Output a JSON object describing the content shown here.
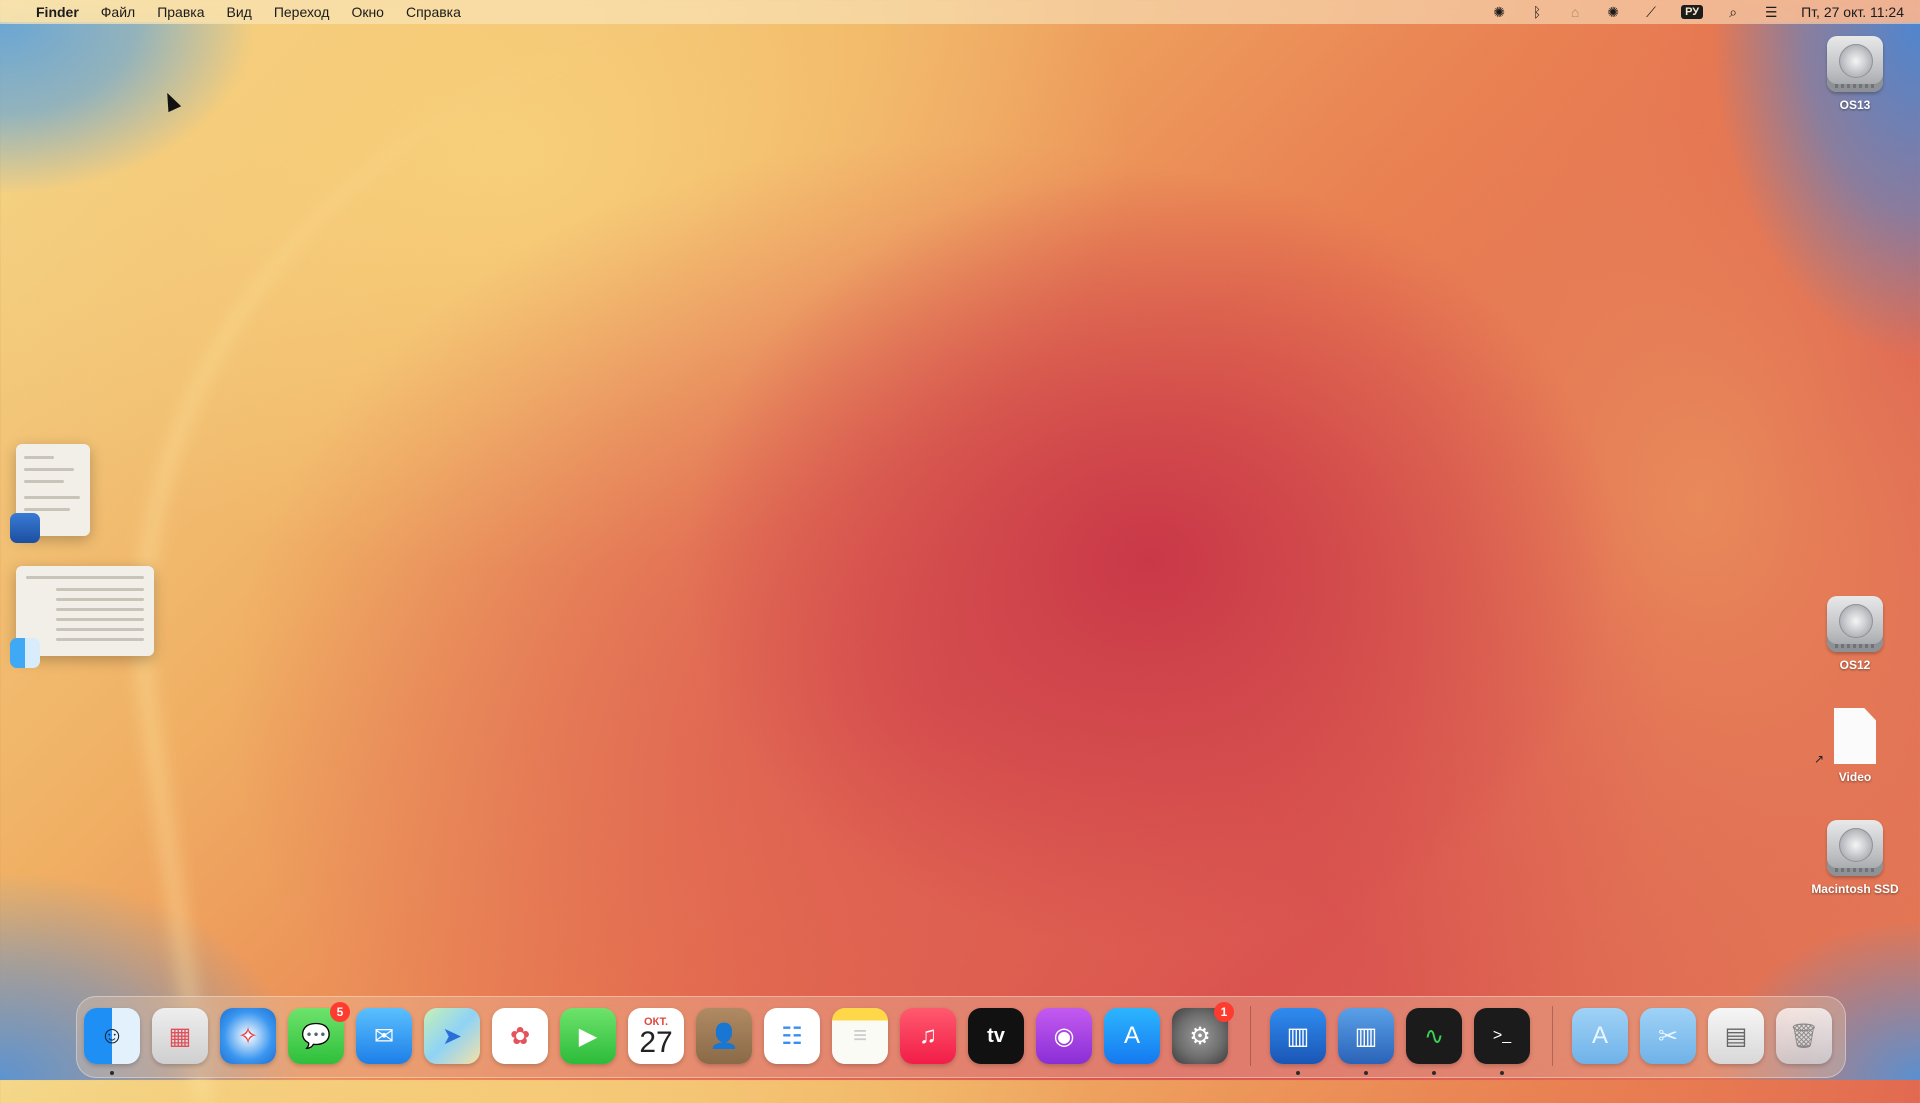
{
  "menubar": {
    "app_name": "Finder",
    "menus": [
      "Файл",
      "Правка",
      "Вид",
      "Переход",
      "Окно",
      "Справка"
    ],
    "input_language": "РУ",
    "datetime": "Пт, 27 окт. 11:24"
  },
  "desktop_icons": [
    {
      "label": "OS13",
      "kind": "disk"
    },
    {
      "label": "OS12",
      "kind": "disk"
    },
    {
      "label": "Video",
      "kind": "alias-document"
    },
    {
      "label": "Macintosh SSD",
      "kind": "disk"
    }
  ],
  "dock": {
    "apps": [
      {
        "name": "finder",
        "icon": "finder-icon",
        "running": true
      },
      {
        "name": "launchpad",
        "icon": "launchpad-icon"
      },
      {
        "name": "safari",
        "icon": "safari-icon"
      },
      {
        "name": "messages",
        "icon": "messages-icon",
        "badge": "5"
      },
      {
        "name": "mail",
        "icon": "mail-icon"
      },
      {
        "name": "maps",
        "icon": "maps-icon"
      },
      {
        "name": "photos",
        "icon": "photos-icon"
      },
      {
        "name": "facetime",
        "icon": "facetime-icon"
      },
      {
        "name": "calendar",
        "icon": "calendar-icon",
        "month": "ОКТ.",
        "day": "27"
      },
      {
        "name": "contacts",
        "icon": "contacts-icon"
      },
      {
        "name": "reminders",
        "icon": "reminders-icon"
      },
      {
        "name": "notes",
        "icon": "notes-icon"
      },
      {
        "name": "music",
        "icon": "music-icon"
      },
      {
        "name": "tv",
        "icon": "tv-icon",
        "label": "tv"
      },
      {
        "name": "podcasts",
        "icon": "podcasts-icon"
      },
      {
        "name": "app-store",
        "icon": "app-store-icon"
      },
      {
        "name": "system-settings",
        "icon": "gear-icon",
        "badge": "1"
      },
      {
        "name": "geekbench-6",
        "icon": "geekbench-icon",
        "running": true
      },
      {
        "name": "geekbench-5",
        "icon": "geekbench-icon-alt",
        "running": true
      },
      {
        "name": "activity-monitor",
        "icon": "activity-monitor-icon",
        "running": true
      },
      {
        "name": "terminal",
        "icon": "terminal-icon",
        "running": true
      }
    ],
    "stacks": [
      {
        "name": "applications-folder",
        "icon": "applications-folder-icon"
      },
      {
        "name": "utilities-folder",
        "icon": "utilities-folder-icon"
      },
      {
        "name": "downloads-stack",
        "icon": "document-stack-icon"
      },
      {
        "name": "trash",
        "icon": "trash-icon"
      }
    ]
  },
  "colors": {
    "badge_red": "#ff3b30",
    "menubar_text": "#1c1c1c",
    "desktop_label": "#ffffff"
  }
}
